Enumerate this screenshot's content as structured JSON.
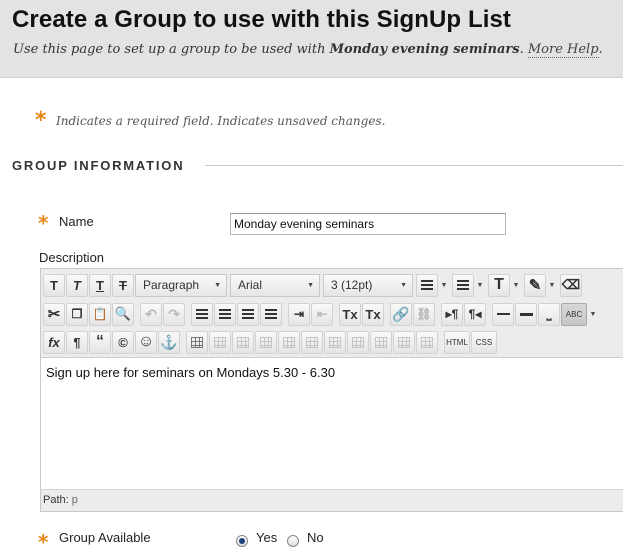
{
  "header": {
    "title": "Create a Group to use with this SignUp List",
    "subtitle_prefix": "Use this page to set up a group to be used with ",
    "subtitle_target": "Monday evening seminars",
    "subtitle_suffix": ". ",
    "more_help": "More Help",
    "subtitle_end": "."
  },
  "required_note": {
    "star": "*",
    "text": "Indicates a required field. Indicates unsaved changes."
  },
  "section": {
    "title": "GROUP INFORMATION"
  },
  "name_field": {
    "star": "*",
    "label": "Name",
    "value": "Monday evening seminars"
  },
  "description": {
    "label": "Description"
  },
  "toolbar": {
    "row1": {
      "bold": "T",
      "italic": "T",
      "underline": "T",
      "strike": "T",
      "format_select": "Paragraph",
      "font_select": "Arial",
      "size_select": "3 (12pt)",
      "text_color": "T"
    },
    "row2": {
      "superscript": "Tx",
      "subscript": "Tx",
      "spellcheck": "ABC"
    },
    "row3": {
      "math": "fx",
      "paragraph": "¶",
      "quote": "“",
      "copyright": "©",
      "emoticon": "☺",
      "anchor": "⚓",
      "html": "HTML",
      "css": "CSS"
    }
  },
  "editor": {
    "content": "Sign up here for seminars on Mondays 5.30 - 6.30",
    "path_label": "Path:",
    "path_value": "p"
  },
  "group_available": {
    "star": "*",
    "label": "Group Available",
    "options": [
      "Yes",
      "No"
    ],
    "selected": "Yes"
  },
  "colors": {
    "accent_star": "#e8861c",
    "header_bg": "#e3e3e3"
  }
}
